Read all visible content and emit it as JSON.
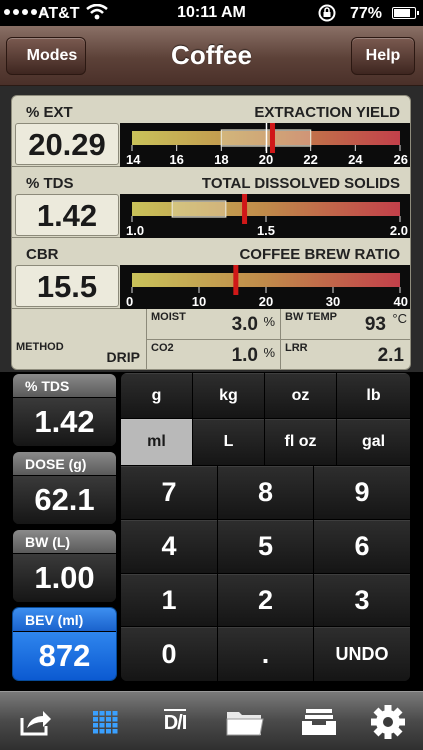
{
  "status": {
    "carrier": "AT&T",
    "time": "10:11 AM",
    "battery": "77%"
  },
  "nav": {
    "back_label": "Modes",
    "title": "Coffee",
    "help_label": "Help"
  },
  "meters": [
    {
      "label": "% EXT",
      "title": "EXTRACTION YIELD",
      "value": "20.29",
      "ticks": [
        "14",
        "16",
        "18",
        "20",
        "22",
        "24",
        "26"
      ],
      "min": 14,
      "max": 26,
      "needle": 20.29,
      "target_low": 18,
      "target_high": 22
    },
    {
      "label": "% TDS",
      "title": "TOTAL DISSOLVED SOLIDS",
      "value": "1.42",
      "ticks": [
        "1.0",
        "1.5",
        "2.0"
      ],
      "min": 1.0,
      "max": 2.0,
      "needle": 1.42,
      "target_low": 1.15,
      "target_high": 1.35
    },
    {
      "label": "CBR",
      "title": "COFFEE BREW RATIO",
      "value": "15.5",
      "ticks": [
        "0",
        "10",
        "20",
        "30",
        "40"
      ],
      "min": 0,
      "max": 40,
      "needle": 15.5
    }
  ],
  "info": {
    "method_label": "METHOD",
    "method_value": "DRIP",
    "moist_label": "MOIST",
    "moist_value": "3.0",
    "moist_unit": "%",
    "co2_label": "CO2",
    "co2_value": "1.0",
    "co2_unit": "%",
    "bw_temp_label": "BW TEMP",
    "bw_temp_value": "93",
    "bw_temp_unit": "°C",
    "lrr_label": "LRR",
    "lrr_value": "2.1"
  },
  "readouts": [
    {
      "label": "% TDS",
      "value": "1.42"
    },
    {
      "label": "DOSE (g)",
      "value": "62.1"
    },
    {
      "label": "BW (L)",
      "value": "1.00"
    },
    {
      "label": "BEV (ml)",
      "value": "872"
    }
  ],
  "units_row1": [
    "g",
    "kg",
    "oz",
    "lb"
  ],
  "units_row2": [
    "ml",
    "L",
    "fl oz",
    "gal"
  ],
  "selected_unit": "ml",
  "keys": {
    "k7": "7",
    "k8": "8",
    "k9": "9",
    "k4": "4",
    "k5": "5",
    "k6": "6",
    "k1": "1",
    "k2": "2",
    "k3": "3",
    "k0": "0",
    "dot": ".",
    "undo": "UNDO"
  },
  "toolbar_icons": [
    "share-icon",
    "keypad-grid-icon",
    "di-icon",
    "folder-icon",
    "inbox-tray-icon",
    "gear-icon"
  ],
  "toolbar_di_text": "D/I",
  "colors": {
    "accent_blue": "#1a6fe0",
    "needle_red": "#d01818",
    "panel": "#d8d6c4"
  }
}
